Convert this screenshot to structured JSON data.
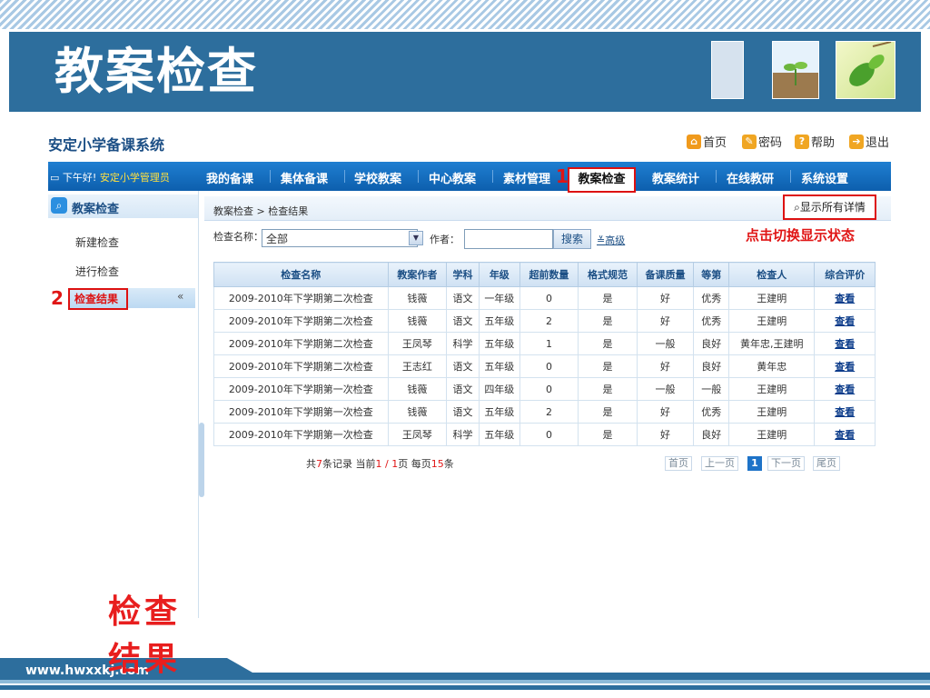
{
  "slide": {
    "title": "教案检查",
    "footer_url": "www.hwxxkj.com",
    "result_caption": "检查结果"
  },
  "colors": {
    "title_bar": "#2d6e9d",
    "nav_bar": "#0d5fad",
    "marker_red": "#e01515"
  },
  "app": {
    "title": "安定小学备课系统",
    "top_links": [
      {
        "label": "首页",
        "icon": "home-icon"
      },
      {
        "label": "密码",
        "icon": "key-icon"
      },
      {
        "label": "帮助",
        "icon": "help-icon"
      },
      {
        "label": "退出",
        "icon": "exit-icon"
      }
    ],
    "greeting_prefix": "下午好!",
    "greeting_user": "安定小学管理员",
    "nav": [
      "我的备课",
      "集体备课",
      "学校教案",
      "中心教案",
      "素材管理",
      "教案检查",
      "教案统计",
      "在线教研",
      "系统设置"
    ],
    "nav_active": "教案检查",
    "markers": {
      "nav": "1",
      "side": "2"
    }
  },
  "sidebar": {
    "header": "教案检查",
    "items": [
      "新建检查",
      "进行检查",
      "检查结果"
    ],
    "active": "检查结果",
    "collapse_symbol": "«"
  },
  "main": {
    "breadcrumb": "教案检查 > 检查结果",
    "show_all_button": "显示所有详情",
    "hint": "点击切换显示状态",
    "search": {
      "name_label": "检查名称：",
      "name_value": "全部",
      "author_label": "作者：",
      "author_value": "",
      "search_button": "搜索",
      "advanced": "高级"
    },
    "table": {
      "headers": [
        "检查名称",
        "教案作者",
        "学科",
        "年级",
        "超前数量",
        "格式规范",
        "备课质量",
        "等第",
        "检查人",
        "综合评价"
      ],
      "rows": [
        [
          "2009-2010年下学期第二次检查",
          "钱薇",
          "语文",
          "一年级",
          "0",
          "是",
          "好",
          "优秀",
          "王建明",
          "查看"
        ],
        [
          "2009-2010年下学期第二次检查",
          "钱薇",
          "语文",
          "五年级",
          "2",
          "是",
          "好",
          "优秀",
          "王建明",
          "查看"
        ],
        [
          "2009-2010年下学期第二次检查",
          "王凤琴",
          "科学",
          "五年级",
          "1",
          "是",
          "一般",
          "良好",
          "黄年忠,王建明",
          "查看"
        ],
        [
          "2009-2010年下学期第二次检查",
          "王志红",
          "语文",
          "五年级",
          "0",
          "是",
          "好",
          "良好",
          "黄年忠",
          "查看"
        ],
        [
          "2009-2010年下学期第一次检查",
          "钱薇",
          "语文",
          "四年级",
          "0",
          "是",
          "一般",
          "一般",
          "王建明",
          "查看"
        ],
        [
          "2009-2010年下学期第一次检查",
          "钱薇",
          "语文",
          "五年级",
          "2",
          "是",
          "好",
          "优秀",
          "王建明",
          "查看"
        ],
        [
          "2009-2010年下学期第一次检查",
          "王凤琴",
          "科学",
          "五年级",
          "0",
          "是",
          "好",
          "良好",
          "王建明",
          "查看"
        ]
      ]
    },
    "pager": {
      "total_prefix": "共",
      "total": "7",
      "total_suffix": "条记录 当前",
      "current": "1 / 1",
      "page_suffix": "页 每页",
      "per_page": "15",
      "per_suffix": "条",
      "first": "首页",
      "prev": "上一页",
      "current_page": "1",
      "next": "下一页",
      "last": "尾页"
    }
  }
}
